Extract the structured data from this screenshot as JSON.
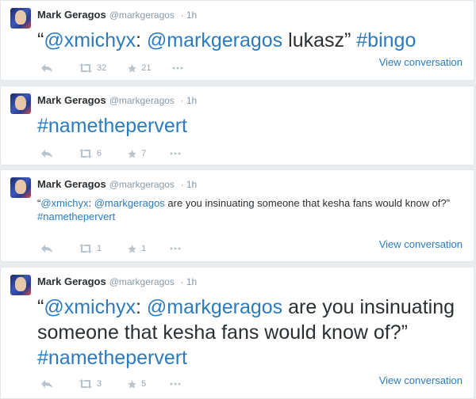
{
  "tweets": [
    {
      "author": "Mark Geragos",
      "handle": "@markgeragos",
      "time": "· 1h",
      "parts": [
        "“",
        "@xmichyx",
        ": ",
        "@markgeragos",
        " lukasz” ",
        "#bingo",
        ""
      ],
      "retweets": "32",
      "favorites": "21",
      "view_label": "View conversation"
    },
    {
      "author": "Mark Geragos",
      "handle": "@markgeragos",
      "time": "· 1h",
      "hashtag": "#namethepervert",
      "retweets": "6",
      "favorites": "7"
    },
    {
      "author": "Mark Geragos",
      "handle": "@markgeragos",
      "time": "· 1h",
      "parts": [
        "“",
        "@xmichyx",
        ": ",
        "@markgeragos",
        " are you insinuating someone that kesha fans would know of?” ",
        "#namethepervert"
      ],
      "retweets": "1",
      "favorites": "1",
      "view_label": "View conversation"
    },
    {
      "author": "Mark Geragos",
      "handle": "@markgeragos",
      "time": "· 1h",
      "parts": [
        "“",
        "@xmichyx",
        ": ",
        "@markgeragos",
        " are you insinuating someone that kesha fans would know of?” ",
        "#namethepervert"
      ],
      "retweets": "3",
      "favorites": "5",
      "view_label": "View conversation"
    }
  ],
  "icons": {
    "reply": "reply-icon",
    "retweet": "retweet-icon",
    "favorite": "star-icon",
    "more": "more-icon"
  },
  "colors": {
    "link": "#2a7bc0",
    "text": "#292f33",
    "meta": "#8899a6",
    "icon": "#b8c3cc",
    "background": "#e9ecef"
  }
}
